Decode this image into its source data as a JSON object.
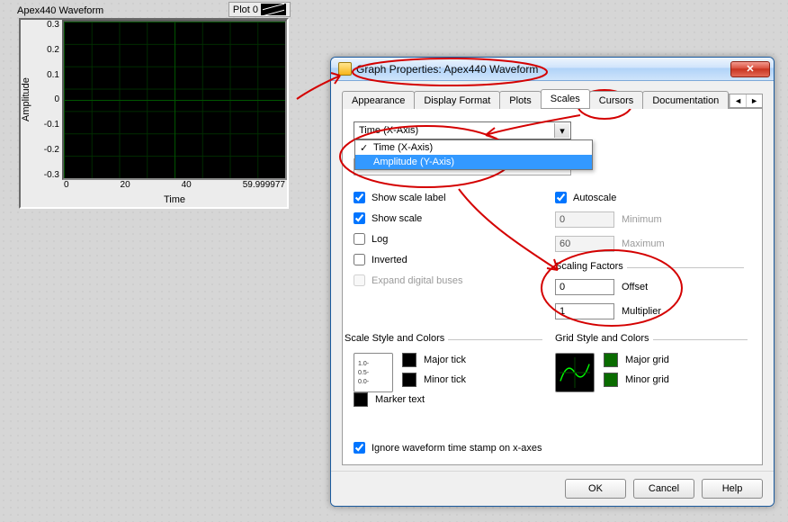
{
  "graph": {
    "title": "Apex440 Waveform",
    "legend_label": "Plot 0",
    "ylabel": "Amplitude",
    "xlabel": "Time",
    "yticks": [
      "0.3",
      "0.2",
      "0.1",
      "0",
      "-0.1",
      "-0.2",
      "-0.3"
    ],
    "xticks": [
      "0",
      "20",
      "40",
      "59.999977"
    ]
  },
  "dialog": {
    "title": "Graph Properties: Apex440 Waveform",
    "tabs": {
      "appearance": "Appearance",
      "display_format": "Display Format",
      "plots": "Plots",
      "scales": "Scales",
      "cursors": "Cursors",
      "documentation": "Documentation"
    },
    "axis_select": "Time (X-Axis)",
    "axis_items": {
      "time": "Time (X-Axis)",
      "amplitude": "Amplitude (Y-Axis)"
    },
    "left_checks": {
      "show_scale_label": "Show scale label",
      "show_scale": "Show scale",
      "log": "Log",
      "inverted": "Inverted",
      "expand": "Expand digital buses"
    },
    "autoscale": "Autoscale",
    "minimum_label": "Minimum",
    "maximum_label": "Maximum",
    "minimum_value": "0",
    "maximum_value": "60",
    "scaling_factors_label": "Scaling Factors",
    "offset_label": "Offset",
    "offset_value": "0",
    "multiplier_label": "Multiplier",
    "multiplier_value": "1",
    "scale_style_label": "Scale Style and Colors",
    "grid_style_label": "Grid Style and Colors",
    "major_tick": "Major tick",
    "minor_tick": "Minor tick",
    "marker_text": "Marker text",
    "major_grid": "Major grid",
    "minor_grid": "Minor grid",
    "ignore_ts": "Ignore waveform time stamp on x-axes",
    "buttons": {
      "ok": "OK",
      "cancel": "Cancel",
      "help": "Help"
    }
  },
  "chart_data": {
    "type": "line",
    "title": "Apex440 Waveform",
    "xlabel": "Time",
    "ylabel": "Amplitude",
    "xlim": [
      0,
      60
    ],
    "ylim": [
      -0.3,
      0.3
    ],
    "series": [
      {
        "name": "Plot 0",
        "values": []
      }
    ]
  }
}
